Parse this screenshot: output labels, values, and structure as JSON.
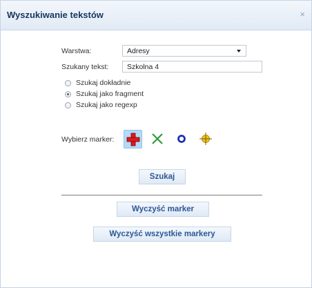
{
  "dialog": {
    "title": "Wyszukiwanie tekstów",
    "close_symbol": "×"
  },
  "form": {
    "layer_label": "Warstwa:",
    "layer_selected": "Adresy",
    "search_label": "Szukany tekst:",
    "search_value": "Szkolna 4",
    "search_modes": [
      {
        "label": "Szukaj dokładnie",
        "checked": false
      },
      {
        "label": "Szukaj jako fragment",
        "checked": true
      },
      {
        "label": "Szukaj jako regexp",
        "checked": false
      }
    ],
    "marker_label": "Wybierz marker:",
    "markers": [
      {
        "icon": "red-cross-marker-icon",
        "color": "#e0191f",
        "selected": true
      },
      {
        "icon": "green-x-marker-icon",
        "color": "#2e9b3a",
        "selected": false
      },
      {
        "icon": "blue-circle-marker-icon",
        "color": "#1b2fb8",
        "selected": false
      },
      {
        "icon": "yellow-crosshair-marker-icon",
        "color": "#f0c419",
        "selected": false
      }
    ]
  },
  "buttons": {
    "search": "Szukaj",
    "clear_marker": "Wyczyść marker",
    "clear_all_markers": "Wyczyść wszystkie markery"
  },
  "colors": {
    "title_text": "#17365d",
    "button_text": "#2b5796",
    "selected_marker_bg": "#b4daf7"
  }
}
